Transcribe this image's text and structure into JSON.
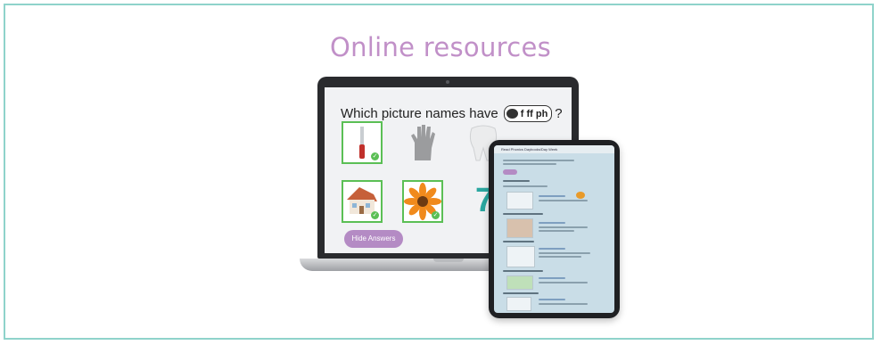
{
  "heading": "Online resources",
  "laptop": {
    "question_prefix": "Which picture names have",
    "question_suffix": "?",
    "phoneme_label": "f ff ph",
    "big_number": "7",
    "hide_answers_label": "Hide Answers",
    "colors": {
      "correct": "#5bbf55",
      "button": "#b48bc4",
      "numeral": "#2ba7a0"
    }
  },
  "tablet": {
    "header_text": "Read Phonics Daybooks/Day Week"
  },
  "colors": {
    "border": "#8fd3cb",
    "heading": "#c190c8"
  }
}
